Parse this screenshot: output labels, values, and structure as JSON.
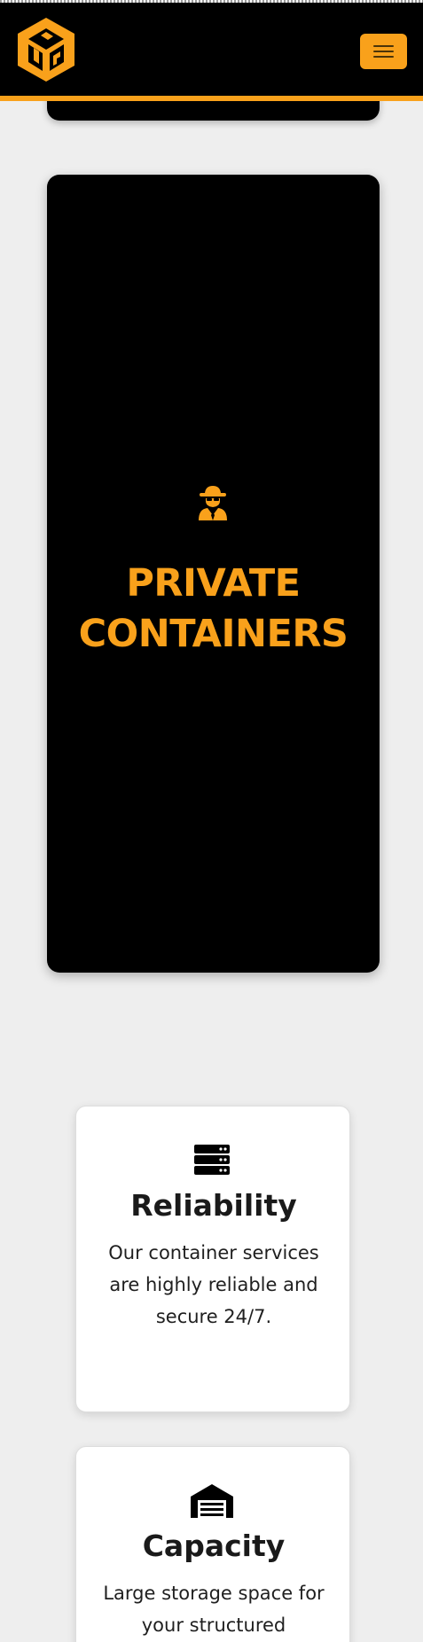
{
  "brand": {
    "logo_icon": "cg-cube-logo-icon",
    "accent_color": "#f9a11b",
    "dark_color": "#000000"
  },
  "nav": {
    "menu_icon": "hamburger-menu-icon"
  },
  "feature": {
    "icon": "spy-incognito-icon",
    "title": "PRIVATE\nCONTAINERS"
  },
  "cards": [
    {
      "icon": "server-stack-icon",
      "title": "Reliability",
      "text": "Our container services are highly reliable and secure 24/7."
    },
    {
      "icon": "warehouse-icon",
      "title": "Capacity",
      "text": "Large storage space for your structured"
    }
  ]
}
